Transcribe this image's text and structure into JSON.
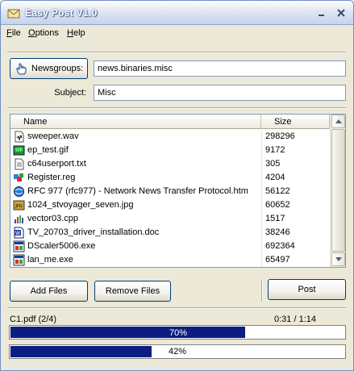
{
  "window": {
    "title": "Easy Post V1.0"
  },
  "menu": {
    "file": "File",
    "file_rest": "ile",
    "file_key": "F",
    "options_key": "O",
    "options_rest": "ptions",
    "help_key": "H",
    "help_rest": "elp"
  },
  "header": {
    "newsgroups_button": "Newsgroups:",
    "newsgroups_value": "news.binaries.misc",
    "subject_label": "Subject:",
    "subject_value": "Misc"
  },
  "file_list": {
    "columns": [
      "Name",
      "Size"
    ],
    "rows": [
      {
        "name": "sweeper.wav",
        "size": "298296",
        "icon": "audio-file-icon"
      },
      {
        "name": "ep_test.gif",
        "size": "9172",
        "icon": "gif-image-icon"
      },
      {
        "name": "c64userport.txt",
        "size": "305",
        "icon": "text-file-icon"
      },
      {
        "name": "Register.reg",
        "size": "4204",
        "icon": "registry-file-icon"
      },
      {
        "name": "RFC 977 (rfc977) - Network News Transfer Protocol.htm",
        "size": "56122",
        "icon": "html-file-icon"
      },
      {
        "name": "1024_stvoyager_seven.jpg",
        "size": "60652",
        "icon": "jpg-image-icon"
      },
      {
        "name": "vector03.cpp",
        "size": "1517",
        "icon": "cpp-file-icon"
      },
      {
        "name": "TV_20703_driver_installation.doc",
        "size": "38246",
        "icon": "word-document-icon"
      },
      {
        "name": "DScaler5006.exe",
        "size": "692364",
        "icon": "exe-file-icon"
      },
      {
        "name": "lan_me.exe",
        "size": "65497",
        "icon": "exe-file-icon"
      }
    ]
  },
  "actions": {
    "add_files": "Add Files",
    "remove_files": "Remove Files",
    "post": "Post"
  },
  "status": {
    "current_file": "C1.pdf (2/4)",
    "time": "0:31 / 1:14",
    "file_progress_label": "70%",
    "file_progress": 0.7,
    "total_progress_label": "42%",
    "total_progress": 0.42
  },
  "colors": {
    "progress_fill": "#0a1e82",
    "title_text": "#ffffff"
  }
}
